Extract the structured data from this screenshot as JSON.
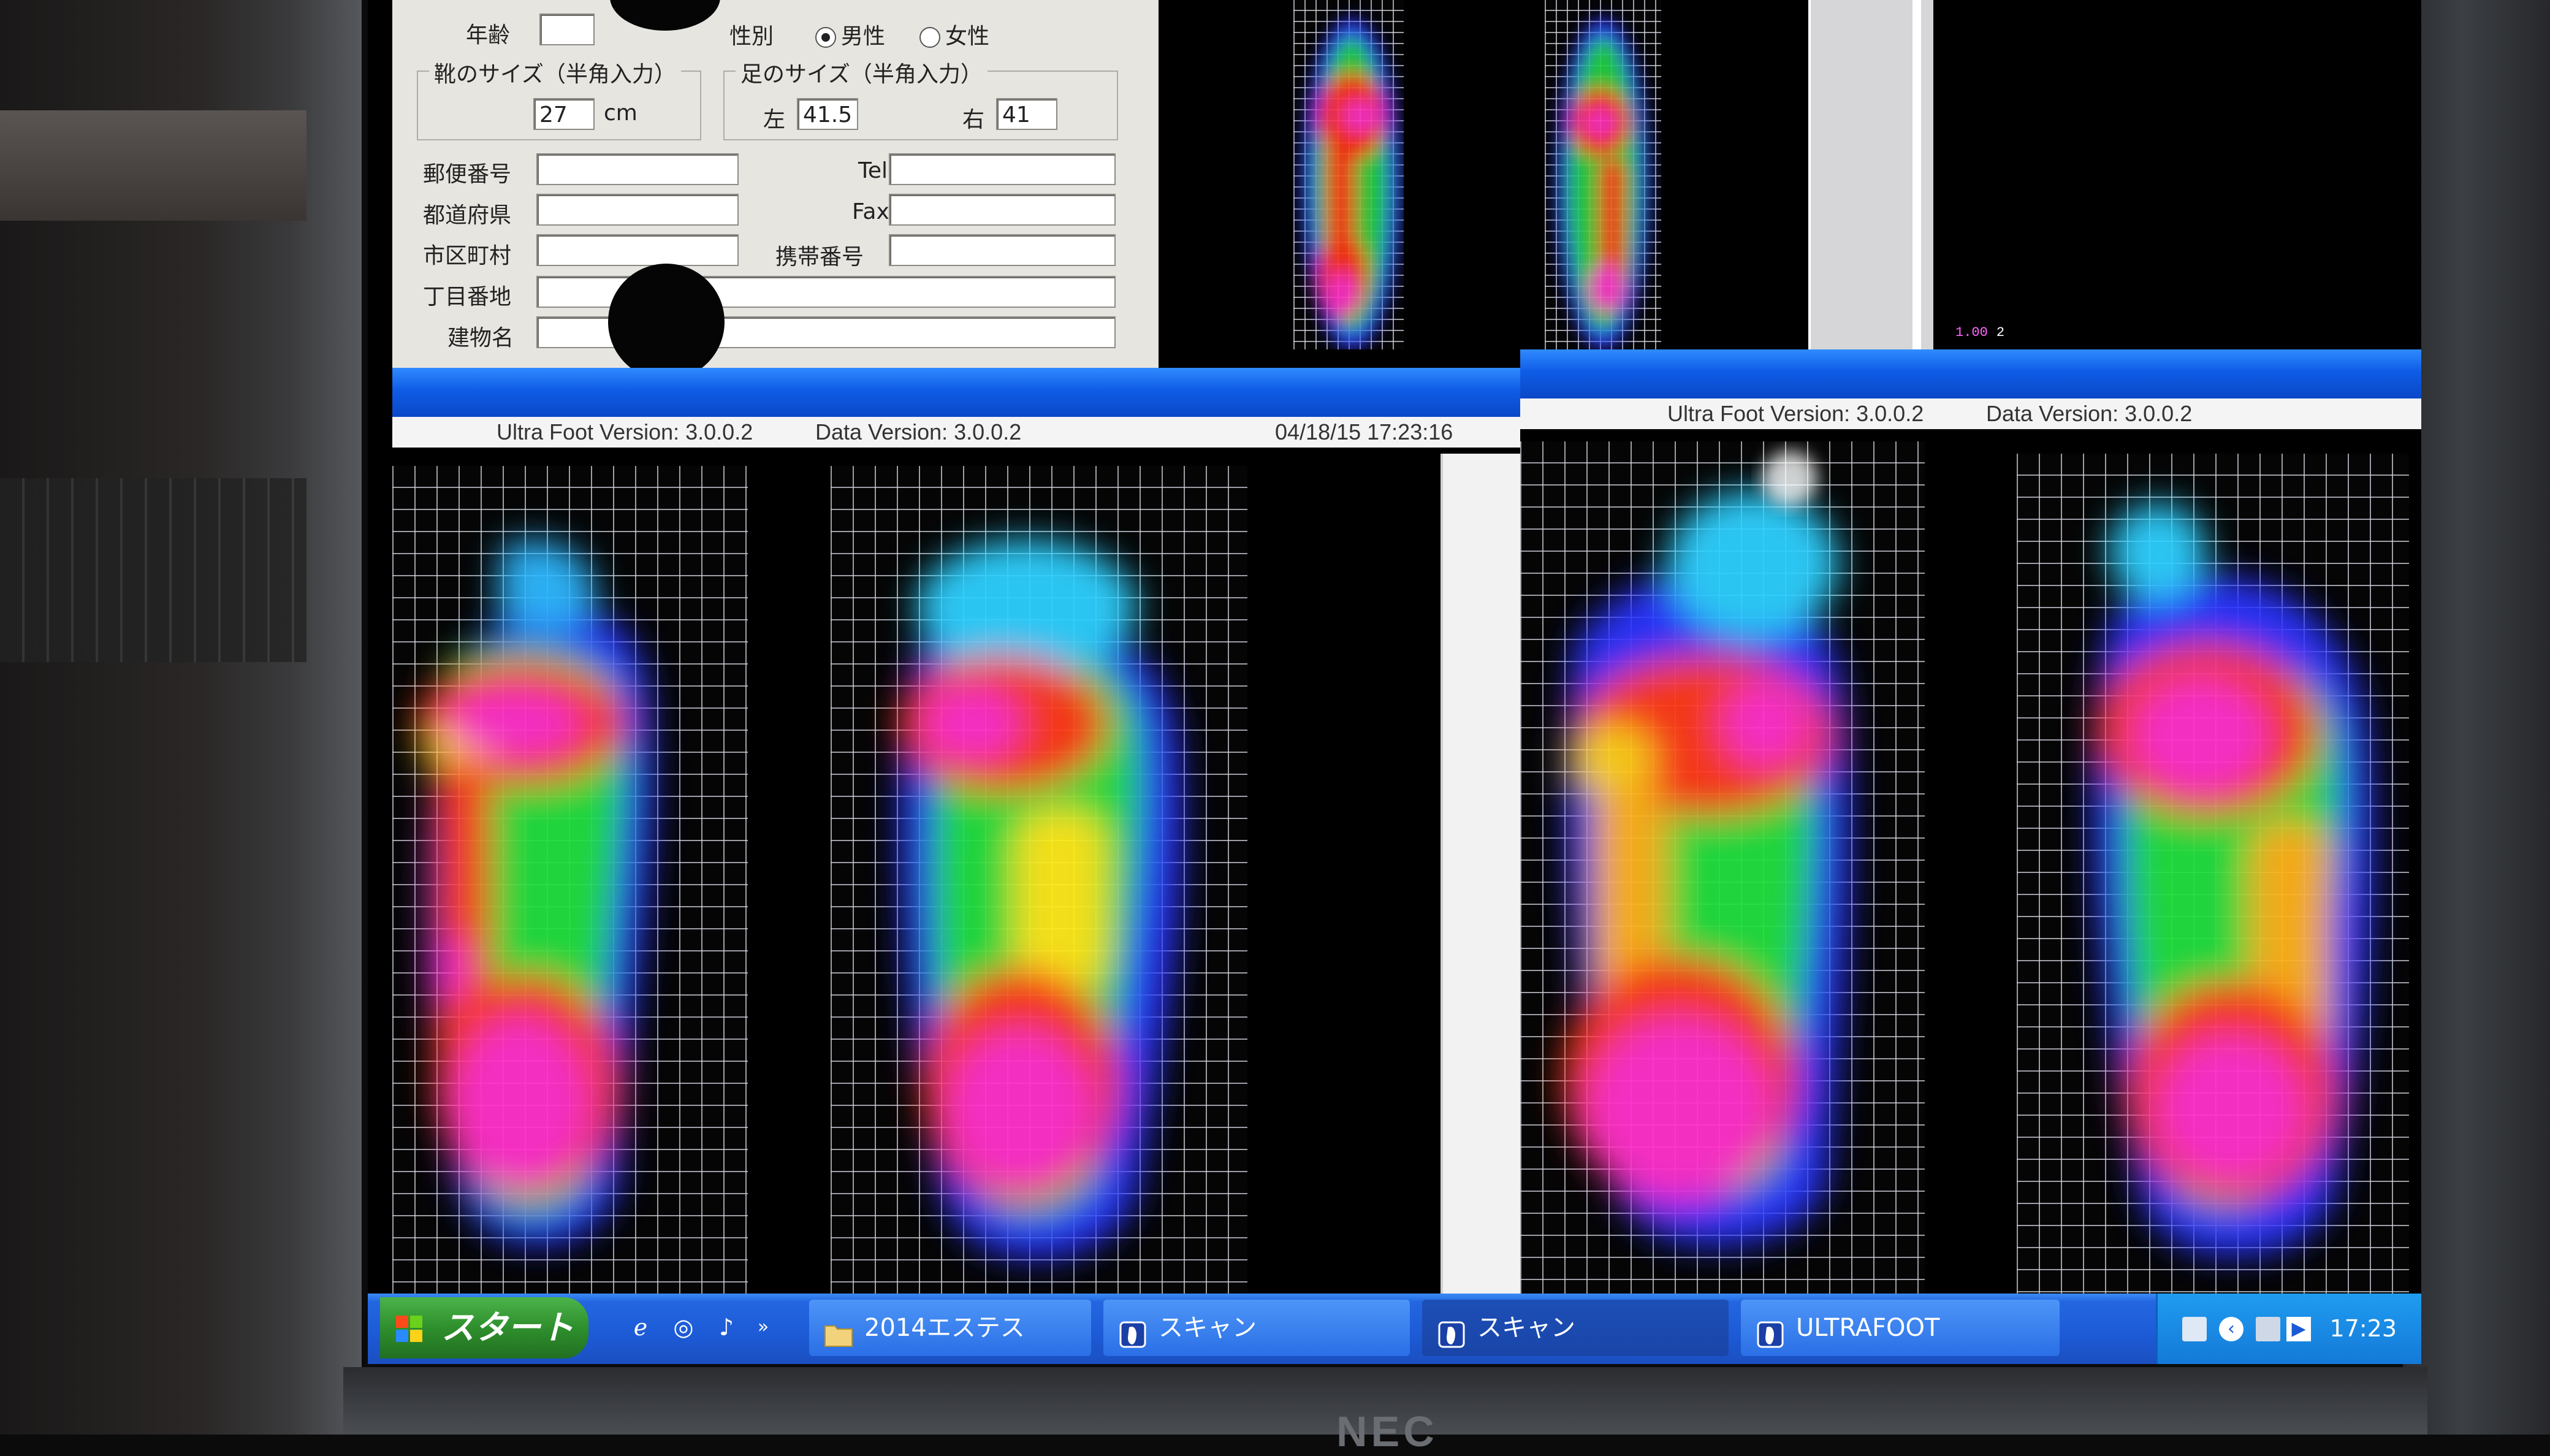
{
  "form": {
    "age_label": "年齢",
    "gender_label": "性別",
    "gender_male": "男性",
    "gender_female": "女性",
    "shoe_size_group": "靴のサイズ（半角入力）",
    "shoe_size_value": "27",
    "shoe_size_unit": "cm",
    "foot_size_group": "足のサイズ（半角入力）",
    "left_label": "左",
    "left_value": "41.5",
    "right_label": "右",
    "right_value": "41",
    "postal_label": "郵便番号",
    "prefecture_label": "都道府県",
    "city_label": "市区町村",
    "block_label": "丁目番地",
    "building_label": "建物名",
    "tel_label": "Tel",
    "fax_label": "Fax",
    "mobile_label": "携帯番号"
  },
  "scale": {
    "a": "1.00",
    "b": "2"
  },
  "left_window": {
    "version": "Ultra Foot Version: 3.0.0.2",
    "data_version": "Data Version: 3.0.0.2",
    "timestamp": "04/18/15 17:23:16"
  },
  "right_window": {
    "version": "Ultra Foot Version: 3.0.0.2",
    "data_version": "Data Version: 3.0.0.2"
  },
  "taskbar": {
    "start_label": "スタート",
    "tasks": [
      {
        "label": "2014エステス"
      },
      {
        "label": "スキャン"
      },
      {
        "label": "スキャン"
      },
      {
        "label": "ULTRAFOOT"
      }
    ],
    "clock": "17:23"
  },
  "colors": {
    "heat_low": "#2030ff",
    "heat_mid": "#20e040",
    "heat_high": "#ff3a1a",
    "heat_peak": "#ff33cc",
    "titlebar": "#0f5ce6"
  }
}
